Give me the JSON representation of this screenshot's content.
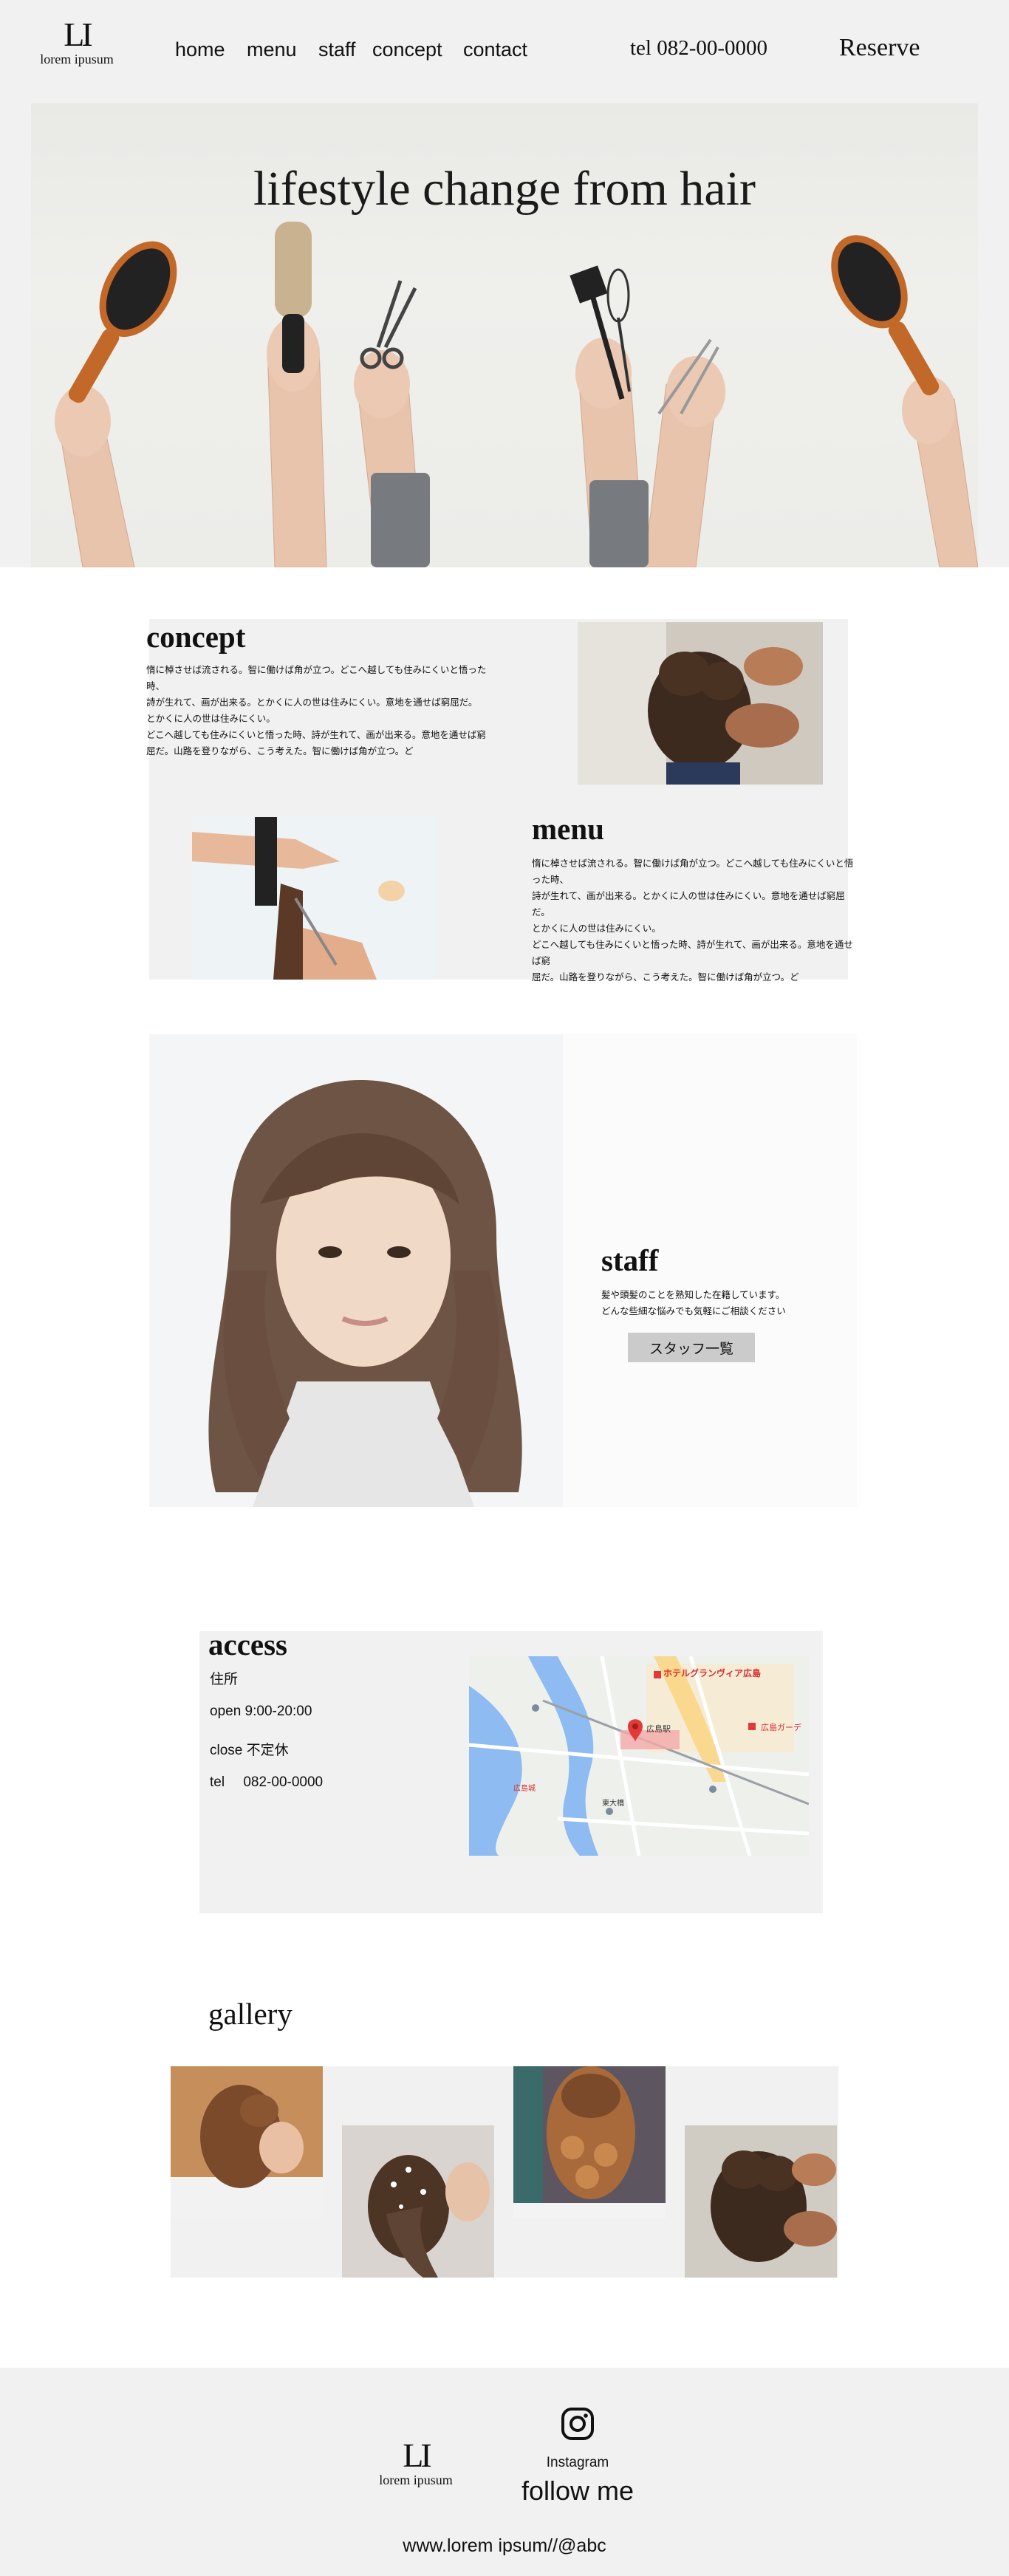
{
  "header": {
    "logo_mark": "LI",
    "logo_text": "lorem ipusum",
    "nav": [
      "home",
      "menu",
      "staff",
      "concept",
      "contact"
    ],
    "tel": "tel 082-00-0000",
    "reserve": "Reserve"
  },
  "hero": {
    "title": "lifestyle change from hair"
  },
  "concept": {
    "title": "concept",
    "lines": [
      "惰に棹させば流される。智に働けば角が立つ。どこへ越しても住みにくいと悟った時、",
      "詩が生れて、画が出来る。とかくに人の世は住みにくい。意地を通せば窮屈だ。",
      "とかくに人の世は住みにくい。",
      "どこへ越しても住みにくいと悟った時、詩が生れて、画が出来る。意地を通せば窮",
      "屈だ。山路を登りながら、こう考えた。智に働けば角が立つ。ど"
    ]
  },
  "menu": {
    "title": "menu",
    "lines": [
      "惰に棹させば流される。智に働けば角が立つ。どこへ越しても住みにくいと悟った時、",
      "詩が生れて、画が出来る。とかくに人の世は住みにくい。意地を通せば窮屈だ。",
      "とかくに人の世は住みにくい。",
      "どこへ越しても住みにくいと悟った時、詩が生れて、画が出来る。意地を通せば窮",
      "屈だ。山路を登りながら、こう考えた。智に働けば角が立つ。ど"
    ]
  },
  "staff": {
    "title": "staff",
    "lines": [
      "髪や頭髪のことを熟知した在籍しています。",
      "どんな些細な悩みでも気軽にご相談ください"
    ],
    "button": "スタッフ一覧"
  },
  "access": {
    "title": "access",
    "address_label": "住所",
    "open": "open 9:00-20:00",
    "close": "close 不定休",
    "tel_label": "tel",
    "tel_value": "082-00-0000",
    "map_labels": {
      "hotel": "ホテルグランヴィア広島",
      "station": "広島駅",
      "garden": "広島ガーデ",
      "castle": "広島城",
      "bridge": "東大橋"
    }
  },
  "gallery": {
    "title": "gallery"
  },
  "footer": {
    "logo_mark": "LI",
    "logo_text": "lorem ipusum",
    "instagram": "Instagram",
    "follow": "follow me",
    "url": "www.lorem ipsum//@abc"
  },
  "colors": {
    "section_bg": "#f1f1f1",
    "button_bg": "#cbcbcb",
    "text": "#111111",
    "map_water": "#7fb3f0",
    "map_pin": "#e03a3a"
  }
}
